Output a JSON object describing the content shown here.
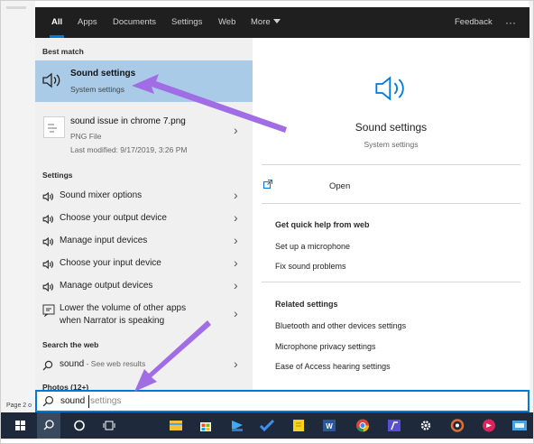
{
  "tabs": [
    {
      "label": "All",
      "active": true
    },
    {
      "label": "Apps"
    },
    {
      "label": "Documents"
    },
    {
      "label": "Settings"
    },
    {
      "label": "Web"
    },
    {
      "label": "More"
    }
  ],
  "feedback_label": "Feedback",
  "more_options_label": "···",
  "best_match": {
    "header": "Best match",
    "title": "Sound settings",
    "subtitle": "System settings"
  },
  "file_result": {
    "title": "sound issue in chrome 7.png",
    "type": "PNG File",
    "modified": "Last modified: 9/17/2019, 3:26 PM"
  },
  "settings_section": {
    "header": "Settings",
    "items": [
      {
        "label": "Sound mixer options"
      },
      {
        "label": "Choose your output device"
      },
      {
        "label": "Manage input devices"
      },
      {
        "label": "Choose your input device"
      },
      {
        "label": "Manage output devices"
      },
      {
        "label": "Lower the volume of other apps",
        "label2": "when Narrator is speaking"
      }
    ]
  },
  "web_section": {
    "header": "Search the web",
    "query": "sound",
    "suffix": " - See web results"
  },
  "photos_header": "Photos (12+)",
  "preview": {
    "title": "Sound settings",
    "subtitle": "System settings",
    "open_label": "Open",
    "quick_help_header": "Get quick help from web",
    "quick_help_links": [
      "Set up a microphone",
      "Fix sound problems"
    ],
    "related_header": "Related settings",
    "related_links": [
      "Bluetooth and other devices settings",
      "Microphone privacy settings",
      "Ease of Access hearing settings"
    ]
  },
  "search": {
    "typed": "sound",
    "suggestion": "settings"
  },
  "status_text": "Page 2 o",
  "colors": {
    "accent": "#0078d7",
    "selected_bg": "#a9cbe8",
    "annotation_arrow": "#a16de5",
    "menu_bg": "#1f1f1f",
    "taskbar_bg": "#1e2a3c"
  },
  "taskbar_icons": [
    "windows-start-icon",
    "search-icon",
    "cortana-icon",
    "task-view-icon",
    "file-explorer-icon",
    "store-icon",
    "edge-icon",
    "app-icon",
    "todo-icon",
    "sticky-notes-icon",
    "word-icon",
    "chrome-icon",
    "app-icon",
    "settings-icon",
    "app-icon",
    "app-icon",
    "app-icon"
  ]
}
